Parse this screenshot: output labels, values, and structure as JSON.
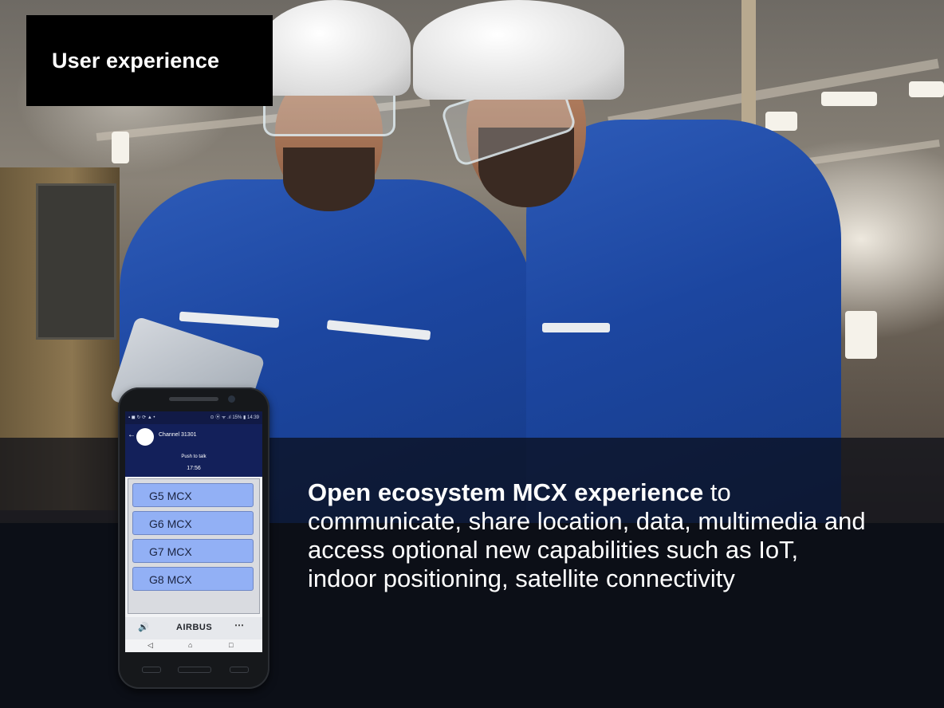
{
  "slide": {
    "title": "User experience",
    "description": {
      "bold": "Open ecosystem MCX experience",
      "rest": " to communicate, share location, data, multimedia and access optional new capabilities such as IoT, indoor positioning, satellite connectivity"
    }
  },
  "phone": {
    "statusbar_left": "▪ ◼ ↻ ⟳ ▲ •",
    "statusbar_right": "⊙ ⦿ ᯤ .ıl 15% ▮ 14:39",
    "channel": "Channel 31301",
    "ptt_label": "Push to talk",
    "time": "17:56",
    "groups": [
      "G5 MCX",
      "G6 MCX",
      "G7 MCX",
      "G8 MCX"
    ],
    "brand": "AIRBUS",
    "icons": {
      "back": "arrow-left-icon",
      "volume": "speaker-icon",
      "more": "more-dots-icon",
      "nav_back": "triangle-back-icon",
      "nav_home": "home-icon",
      "nav_recent": "square-recent-icon"
    }
  },
  "colors": {
    "background": "#0c0f17",
    "title_box": "#000000",
    "suit_blue": "#1c46a0",
    "app_header": "#13205a",
    "group_button": "#92b0f5"
  }
}
